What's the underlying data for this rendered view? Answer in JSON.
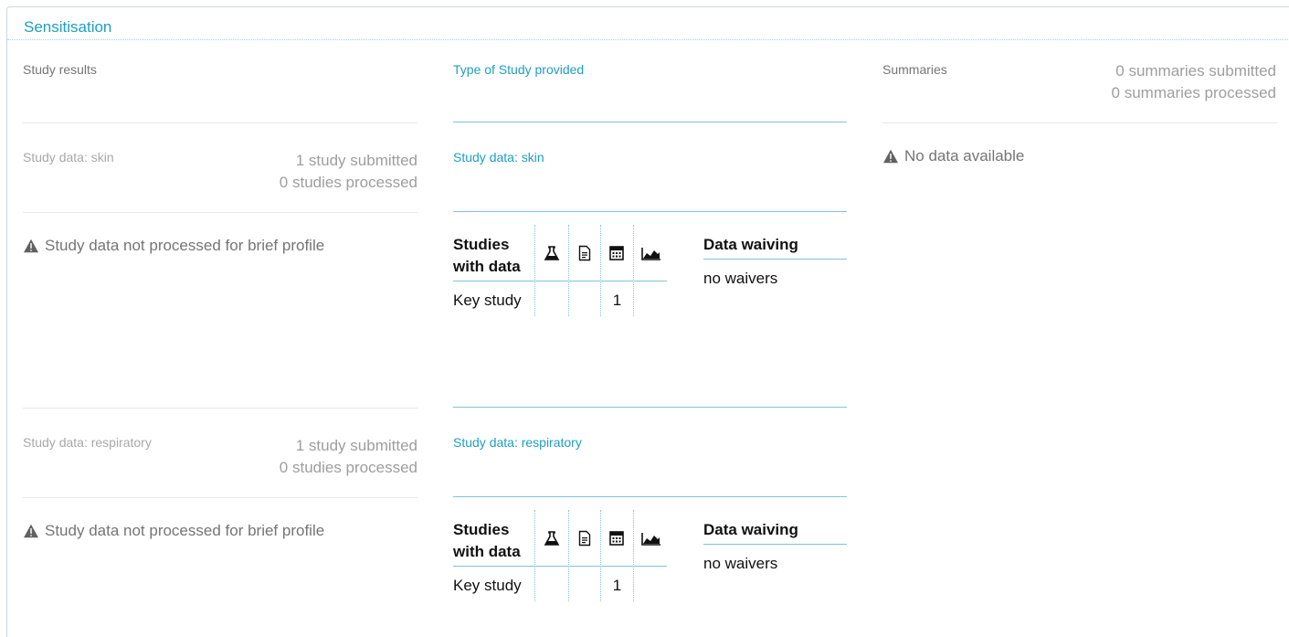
{
  "section": {
    "title": "Sensitisation"
  },
  "columns": {
    "results_title": "Study results",
    "type_title": "Type of Study provided",
    "summaries_title": "Summaries"
  },
  "summaries": {
    "submitted": "0 summaries submitted",
    "processed": "0 summaries processed",
    "no_data": "No data available"
  },
  "blocks": [
    {
      "label": "Study data: skin",
      "submitted": "1 study submitted",
      "processed": "0 studies processed",
      "warning": "Study data not processed for brief profile",
      "type_label": "Study data: skin",
      "table": {
        "header": "Studies with data",
        "row_label": "Key study",
        "values": [
          "",
          "",
          "1",
          ""
        ]
      },
      "waiving": {
        "header": "Data waiving",
        "value": "no waivers"
      }
    },
    {
      "label": "Study data: respiratory",
      "submitted": "1 study submitted",
      "processed": "0 studies processed",
      "warning": "Study data not processed for brief profile",
      "type_label": "Study data: respiratory",
      "table": {
        "header": "Studies with data",
        "row_label": "Key study",
        "values": [
          "",
          "",
          "1",
          ""
        ]
      },
      "waiving": {
        "header": "Data waiving",
        "value": "no waivers"
      }
    }
  ],
  "icons": {
    "table_columns": [
      "flask-icon",
      "document-icon",
      "calculator-icon",
      "area-chart-icon"
    ],
    "warning": "warning-icon"
  },
  "colors": {
    "accent": "#1e9fc0",
    "muted_text": "#757575",
    "light_text": "#a8a8a8"
  }
}
